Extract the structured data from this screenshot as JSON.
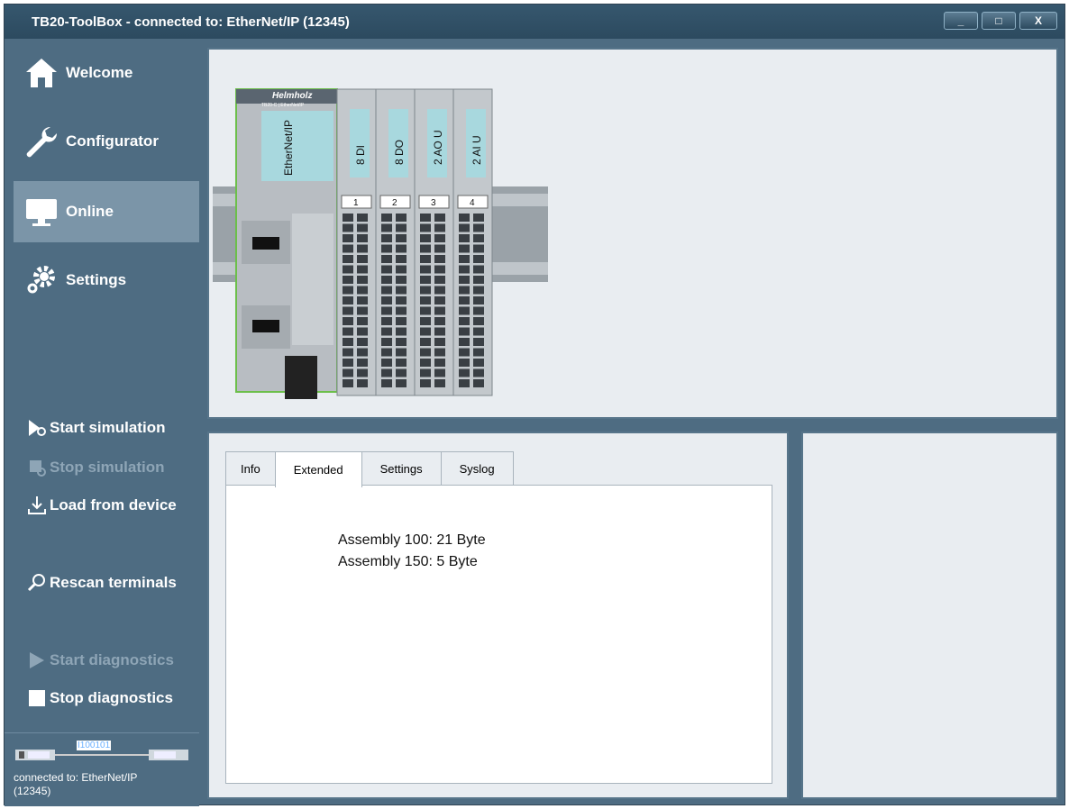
{
  "window": {
    "title": "TB20-ToolBox - connected to: EtherNet/IP (12345)",
    "controls": [
      "_",
      "□",
      "X"
    ]
  },
  "sidebar": {
    "nav": [
      {
        "label": "Welcome",
        "icon": "home-icon"
      },
      {
        "label": "Configurator",
        "icon": "wrench-icon"
      },
      {
        "label": "Online",
        "icon": "monitor-icon",
        "active": true
      },
      {
        "label": "Settings",
        "icon": "gears-icon"
      }
    ],
    "actions": [
      {
        "label": "Start simulation",
        "icon": "play-gear-icon",
        "enabled": true
      },
      {
        "label": "Stop simulation",
        "icon": "stop-gear-icon",
        "enabled": false
      },
      {
        "label": "Load from device",
        "icon": "download-icon",
        "enabled": true
      },
      {
        "label": "Rescan terminals",
        "icon": "magnifier-icon",
        "enabled": true
      },
      {
        "label": "Start diagnostics",
        "icon": "play-icon",
        "enabled": false
      },
      {
        "label": "Stop diagnostics",
        "icon": "stop-square-icon",
        "enabled": true
      }
    ],
    "connection": {
      "bits": "I100101",
      "status": "connected to: EtherNet/IP (12345)"
    }
  },
  "device": {
    "brand": "Helmholz",
    "model": "TB20-C | EtherNet/IP",
    "coupler_label": "EtherNet/IP",
    "modules": [
      {
        "slot": "1",
        "label": "8 DI"
      },
      {
        "slot": "2",
        "label": "8 DO"
      },
      {
        "slot": "3",
        "label": "2 AO U"
      },
      {
        "slot": "4",
        "label": "2 AI U"
      }
    ]
  },
  "tabs": {
    "items": [
      {
        "label": "Info",
        "active": false
      },
      {
        "label": "Extended",
        "active": true
      },
      {
        "label": "Settings",
        "active": false
      },
      {
        "label": "Syslog",
        "active": false
      }
    ],
    "extended": {
      "lines": [
        "Assembly 100: 21 Byte",
        "Assembly 150: 5 Byte"
      ]
    }
  },
  "colors": {
    "sidebar": "#4e6c82",
    "active_nav": "#7b95a8",
    "panel_bg": "#e9edf1",
    "module_window": "#a8d8de",
    "coupler_border": "#6cbf4a"
  }
}
